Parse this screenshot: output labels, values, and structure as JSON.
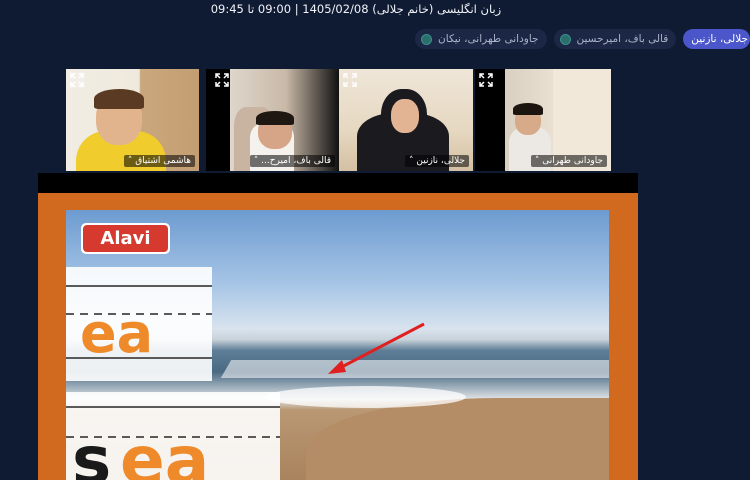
{
  "header": {
    "title": "زبان انگلیسی (خانم جلالی) 1405/02/08 | 09:00 تا 09:45"
  },
  "participant_chips": [
    {
      "label": "جاودانی طهرانی، نیکان",
      "active": false
    },
    {
      "label": "قالی باف، امیرحسین",
      "active": false
    },
    {
      "label": "جلالی، نازنین",
      "active": true
    }
  ],
  "video_tiles": [
    {
      "name": "هاشمی اشتیاق",
      "icon": "expand-icon"
    },
    {
      "name": "قالی باف، امیرح...",
      "icon": "expand-icon"
    },
    {
      "name": "جلالی، نازنین",
      "icon": "expand-icon",
      "focused": true
    },
    {
      "name": "جاودانی طهرانی",
      "icon": "expand-icon"
    }
  ],
  "slide": {
    "logo": "Alavi",
    "word1": {
      "part": "ea"
    },
    "word2": {
      "first": "s",
      "rest": "ea"
    }
  },
  "colors": {
    "background": "#0f1a33",
    "active_chip": "#4a56c9",
    "stage_frame": "#d16a1e",
    "focus_outline": "#2d6fd6",
    "letter_orange": "#ef8a2a",
    "arrow": "#e02020"
  }
}
